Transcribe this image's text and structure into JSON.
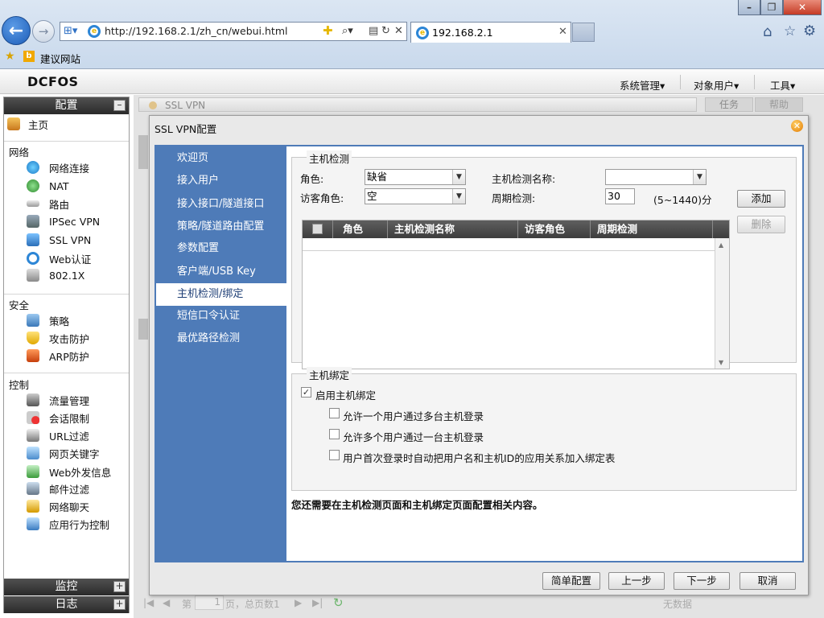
{
  "browser": {
    "url": "http://192.168.2.1/zh_cn/webui.html",
    "tab_title": "192.168.2.1",
    "favorite_link": "建议网站",
    "icons": [
      "back-icon",
      "forward-icon",
      "compat-icon",
      "search-icon",
      "refresh-icon",
      "stop-icon",
      "home-icon",
      "favorites-icon",
      "tools-icon"
    ]
  },
  "app": {
    "logo": "DCFOS",
    "menu": [
      "系统管理▾",
      "对象用户▾",
      "工具▾"
    ]
  },
  "sidebar": {
    "header": "配置",
    "home": "主页",
    "sections": [
      {
        "title": "网络",
        "items": [
          "网络连接",
          "NAT",
          "路由",
          "IPSec VPN",
          "SSL VPN",
          "Web认证",
          "802.1X"
        ]
      },
      {
        "title": "安全",
        "items": [
          "策略",
          "攻击防护",
          "ARP防护"
        ]
      },
      {
        "title": "控制",
        "items": [
          "流量管理",
          "会话限制",
          "URL过滤",
          "网页关键字",
          "Web外发信息",
          "邮件过滤",
          "网络聊天",
          "应用行为控制"
        ]
      }
    ],
    "footer": [
      "监控",
      "日志"
    ]
  },
  "background": {
    "tab_label": "SSL VPN",
    "right_tabs": [
      "任务",
      "帮助"
    ],
    "pager_page_label": "第",
    "pager_page_value": "1",
    "pager_total": "页，总页数1",
    "pager_empty": "无数据"
  },
  "dialog": {
    "title": "SSL VPN配置",
    "steps": [
      "欢迎页",
      "接入用户",
      "接入接口/隧道接口",
      "策略/隧道路由配置",
      "参数配置",
      "客户端/USB Key",
      "主机检测/绑定",
      "短信口令认证",
      "最优路径检测"
    ],
    "active_step": 6,
    "host_check": {
      "legend": "主机检测",
      "role_label": "角色:",
      "role_value": "缺省",
      "name_label": "主机检测名称:",
      "name_value": "",
      "guest_role_label": "访客角色:",
      "guest_role_value": "空",
      "period_label": "周期检测:",
      "period_value": "30",
      "period_hint": "(5~1440)分",
      "add_button": "添加",
      "delete_button": "删除",
      "columns": [
        "角色",
        "主机检测名称",
        "访客角色",
        "周期检测"
      ]
    },
    "host_bind": {
      "legend": "主机绑定",
      "enable_label": "启用主机绑定",
      "enable_checked": true,
      "options": [
        {
          "label": "允许一个用户通过多台主机登录",
          "checked": false
        },
        {
          "label": "允许多个用户通过一台主机登录",
          "checked": false
        },
        {
          "label": "用户首次登录时自动把用户名和主机ID的应用关系加入绑定表",
          "checked": false
        }
      ]
    },
    "note": "您还需要在主机检测页面和主机绑定页面配置相关内容。",
    "buttons": {
      "simple": "简单配置",
      "prev": "上一步",
      "next": "下一步",
      "cancel": "取消"
    }
  }
}
